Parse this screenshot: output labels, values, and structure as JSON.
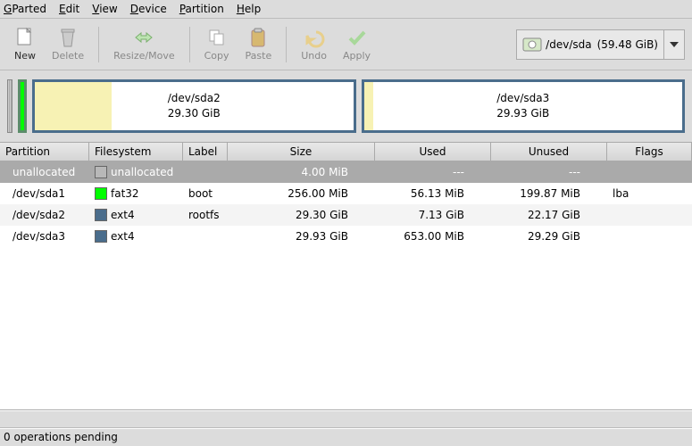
{
  "menu": {
    "gparted": "GParted",
    "edit": "Edit",
    "view": "View",
    "device": "Device",
    "partition": "Partition",
    "help": "Help"
  },
  "toolbar": {
    "new_": "New",
    "delete_": "Delete",
    "resize": "Resize/Move",
    "copy": "Copy",
    "paste": "Paste",
    "undo": "Undo",
    "apply": "Apply"
  },
  "device": {
    "path": "/dev/sda",
    "size": "(59.48 GiB)"
  },
  "map": {
    "sda2": {
      "path": "/dev/sda2",
      "size": "29.30 GiB"
    },
    "sda3": {
      "path": "/dev/sda3",
      "size": "29.93 GiB"
    }
  },
  "columns": {
    "partition": "Partition",
    "filesystem": "Filesystem",
    "label": "Label",
    "size": "Size",
    "used": "Used",
    "unused": "Unused",
    "flags": "Flags"
  },
  "rows": [
    {
      "partition": "unallocated",
      "fs": "unallocated",
      "fs_class": "sw-unalloc",
      "label": "",
      "size": "4.00 MiB",
      "used": "---",
      "unused": "---",
      "flags": "",
      "selected": true
    },
    {
      "partition": "/dev/sda1",
      "fs": "fat32",
      "fs_class": "sw-fat32",
      "label": "boot",
      "size": "256.00 MiB",
      "used": "56.13 MiB",
      "unused": "199.87 MiB",
      "flags": "lba"
    },
    {
      "partition": "/dev/sda2",
      "fs": "ext4",
      "fs_class": "sw-ext4",
      "label": "rootfs",
      "size": "29.30 GiB",
      "used": "7.13 GiB",
      "unused": "22.17 GiB",
      "flags": ""
    },
    {
      "partition": "/dev/sda3",
      "fs": "ext4",
      "fs_class": "sw-ext4",
      "label": "",
      "size": "29.93 GiB",
      "used": "653.00 MiB",
      "unused": "29.29 GiB",
      "flags": ""
    }
  ],
  "status": "0 operations pending"
}
